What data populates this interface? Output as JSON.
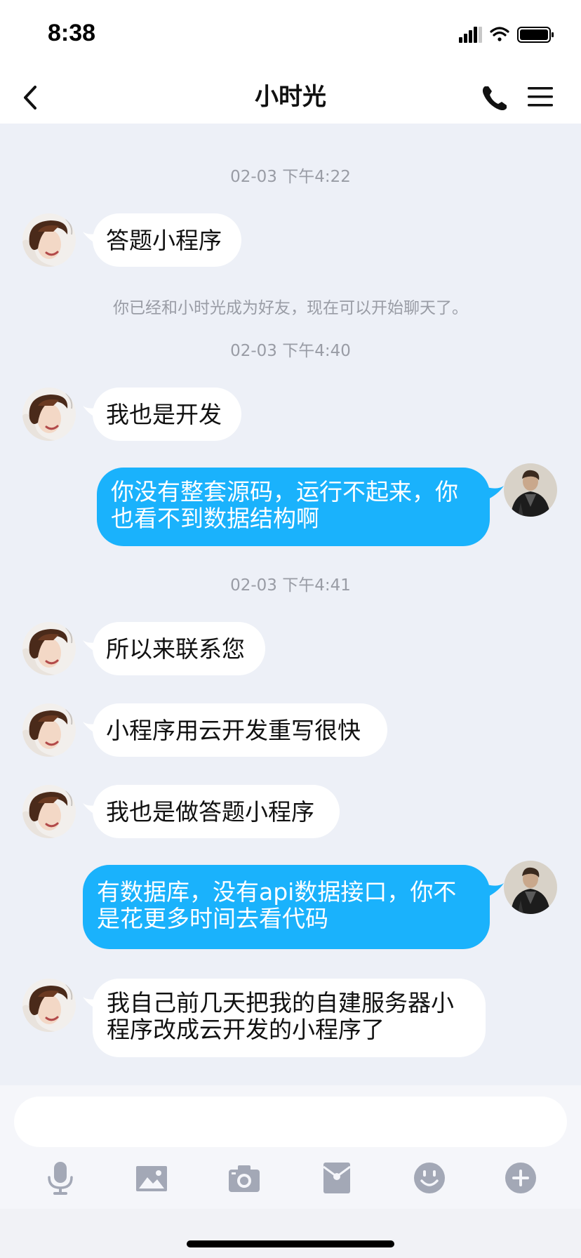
{
  "status": {
    "time": "8:38"
  },
  "header": {
    "title": "小时光"
  },
  "messages": [
    {
      "type": "time",
      "text": "02-03 下午4:22"
    },
    {
      "type": "in",
      "text": "答题小程序"
    },
    {
      "type": "system",
      "text": "你已经和小时光成为好友，现在可以开始聊天了。"
    },
    {
      "type": "time",
      "text": "02-03 下午4:40"
    },
    {
      "type": "in",
      "text": "我也是开发"
    },
    {
      "type": "out",
      "text": "你没有整套源码，运行不起来，你也看不到数据结构啊"
    },
    {
      "type": "time",
      "text": "02-03 下午4:41"
    },
    {
      "type": "in",
      "text": "所以来联系您"
    },
    {
      "type": "in",
      "text": "小程序用云开发重写很快"
    },
    {
      "type": "in",
      "text": "我也是做答题小程序"
    },
    {
      "type": "out",
      "text": "有数据库，没有api数据接口，你不是花更多时间去看代码"
    },
    {
      "type": "in",
      "text": "我自己前几天把我的自建服务器小程序改成云开发的小程序了"
    }
  ],
  "input": {
    "value": "",
    "placeholder": ""
  },
  "toolbar": [
    "microphone-icon",
    "image-icon",
    "camera-icon",
    "red-packet-icon",
    "emoji-icon",
    "plus-icon"
  ],
  "colors": {
    "outgoing_bubble": "#1ab2fc",
    "incoming_bubble": "#ffffff",
    "chat_background": "#edf0f7",
    "toolbar_icon": "#a3a8b6"
  }
}
